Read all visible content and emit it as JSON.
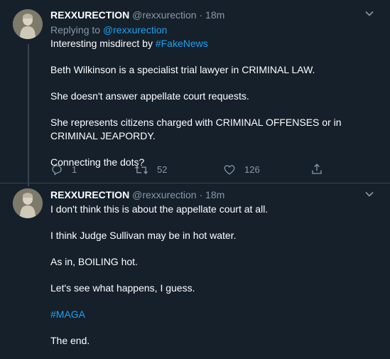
{
  "tweet1": {
    "display_name": "REXXURECTION",
    "handle": "@rexxurection",
    "separator": "·",
    "time": "18m",
    "replying_prefix": "Replying to",
    "replying_handle": "@rexxurection",
    "line1_text": "Interesting misdirect by ",
    "line1_hashtag": "#FakeNews",
    "para2": "Beth Wilkinson is a specialist trial lawyer in CRIMINAL LAW.",
    "para3": "She doesn't answer appellate court requests.",
    "para4": "She represents citizens charged with CRIMINAL OFFENSES or in CRIMINAL JEAPORDY.",
    "para5": "Connecting the dots?",
    "reply_count": "1",
    "retweet_count": "52",
    "like_count": "126"
  },
  "tweet2": {
    "display_name": "REXXURECTION",
    "handle": "@rexxurection",
    "separator": "·",
    "time": "18m",
    "para1": "I don't think this is about the appellate court at all.",
    "para2": "I think Judge Sullivan may be in hot water.",
    "para3": "As in, BOILING hot.",
    "para4": "Let's see what happens, I guess.",
    "hashtag": "#MAGA",
    "para6": "The end."
  },
  "colors": {
    "background": "#15202b",
    "text": "#ffffff",
    "secondary": "#8899a6",
    "link": "#1da1f2",
    "border": "#38444d"
  },
  "icons": [
    "chevron-down-icon",
    "reply-icon",
    "retweet-icon",
    "like-icon",
    "share-icon"
  ]
}
